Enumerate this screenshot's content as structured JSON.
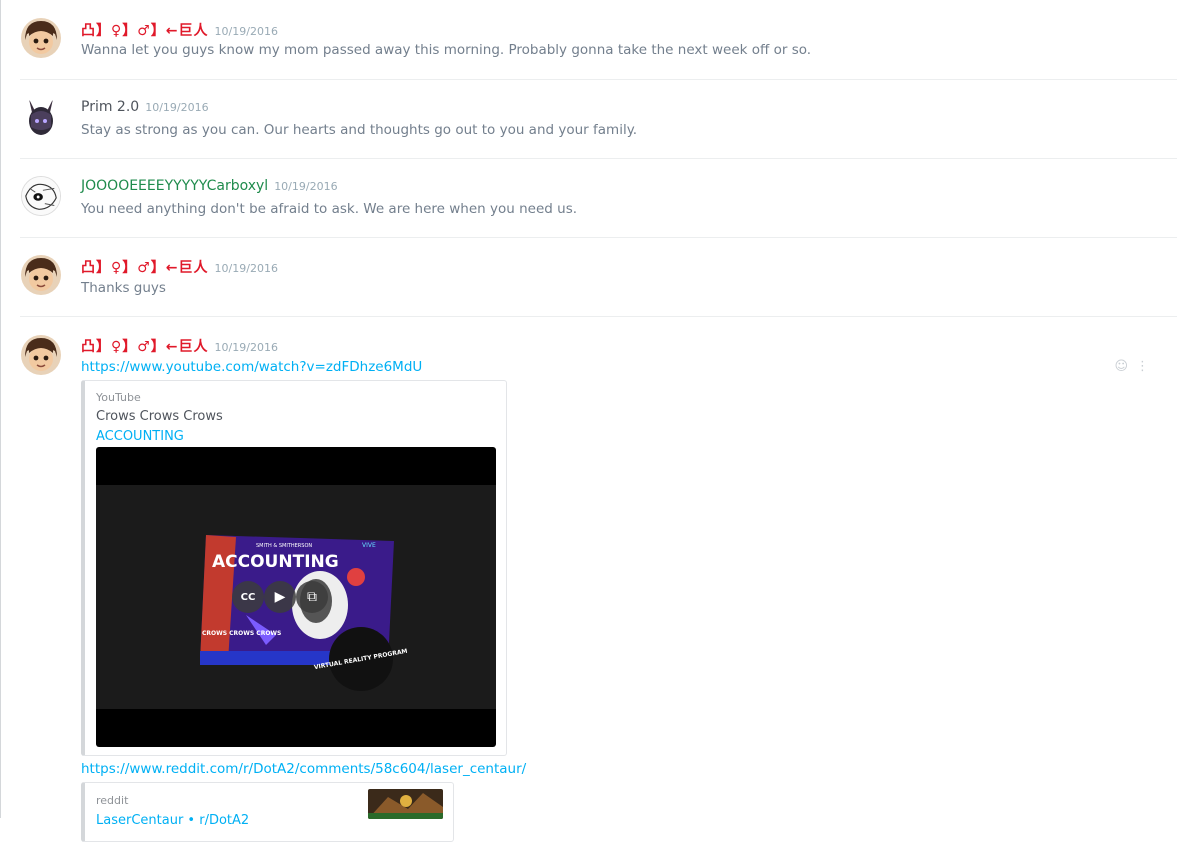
{
  "messages": [
    {
      "author": "凸】♀】♂】←巨人",
      "timestamp": "10/19/2016",
      "text": "Wanna let you guys know my mom passed away this morning. Probably gonna take the next week off or so."
    },
    {
      "author": "Prim 2.0",
      "timestamp": "10/19/2016",
      "text": "Stay as strong as you can. Our hearts and thoughts go out to you and your family."
    },
    {
      "author": "JOOOOEEEEYYYYYCarboxyl",
      "timestamp": "10/19/2016",
      "text": "You need anything don't be afraid to ask. We are here when you need us."
    },
    {
      "author": "凸】♀】♂】←巨人",
      "timestamp": "10/19/2016",
      "text": "Thanks guys"
    },
    {
      "author": "凸】♀】♂】←巨人",
      "timestamp": "10/19/2016",
      "link1": "https://www.youtube.com/watch?v=zdFDhze6MdU",
      "embed1": {
        "provider": "YouTube",
        "author": "Crows Crows Crows",
        "title": "ACCOUNTING",
        "thumb_title": "ACCOUNTING",
        "thumb_brand": "SMITH & SMITHERSON",
        "thumb_logo": "VIVE",
        "thumb_publisher": "CROWS CROWS CROWS",
        "thumb_badge": "VIRTUAL REALITY PROGRAM",
        "cc_label": "CC"
      },
      "link2": "https://www.reddit.com/r/DotA2/comments/58c604/laser_centaur/",
      "embed2": {
        "provider": "reddit",
        "title": "LaserCentaur • r/DotA2"
      }
    }
  ],
  "colors": {
    "accent_link": "#00b0f4",
    "author_red": "#e0192a",
    "author_green": "#1f8b4c",
    "text_muted": "#737f8d"
  },
  "icons": [
    "play-icon",
    "popout-icon",
    "emoji-icon",
    "more-options-icon"
  ]
}
